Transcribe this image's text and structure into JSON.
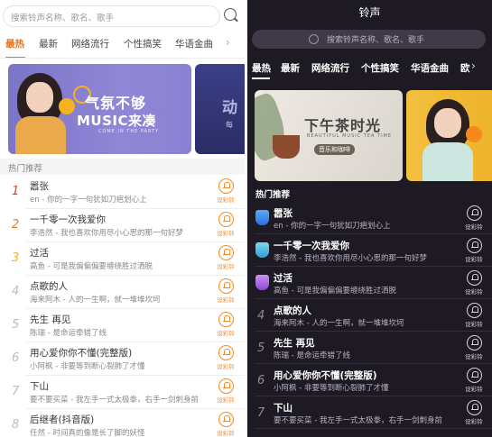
{
  "light": {
    "search": {
      "placeholder": "搜索铃声名称、歌名、歌手"
    },
    "tabs": [
      {
        "label": "最热",
        "active": true
      },
      {
        "label": "最新"
      },
      {
        "label": "网络流行"
      },
      {
        "label": "个性搞笑"
      },
      {
        "label": "华语金曲"
      }
    ],
    "banner": {
      "line1": "气氛不够",
      "line2": "MUSIC来凑",
      "line3": "COME IN THE PARTY"
    },
    "banner_next": {
      "title": "动",
      "sub": "每"
    },
    "section_title": "热门推荐",
    "set_label": "设彩铃",
    "songs": [
      {
        "rank": "1",
        "title": "嚣张",
        "sub": "en - 你的一字一句犹如刀疤划心上"
      },
      {
        "rank": "2",
        "title": "一千零一次我爱你",
        "sub": "李浩然 - 我也喜欢你用尽小心思的那一句好梦"
      },
      {
        "rank": "3",
        "title": "过活",
        "sub": "高鱼 - 可是我偏偏偏要缠绕胜过洒脱"
      },
      {
        "rank": "4",
        "title": "点歌的人",
        "sub": "海来阿木 - 人的一生啊，就一堆堆坎坷"
      },
      {
        "rank": "5",
        "title": "先生 再见",
        "sub": "陈瑞 - 是命运牵错了线"
      },
      {
        "rank": "6",
        "title": "用心爱你你不懂(完整版)",
        "sub": "小阿枫 - 非要等到断心裂肺了才懂"
      },
      {
        "rank": "7",
        "title": "下山",
        "sub": "要不要买菜 - 我左手一式太极拳，右手一剑刺身前"
      },
      {
        "rank": "8",
        "title": "后继者(抖音版)",
        "sub": "任然 - 时间真的像是长了脚的妖怪"
      }
    ]
  },
  "dark": {
    "title": "铃声",
    "search": {
      "placeholder": "搜索铃声名称、歌名、歌手"
    },
    "tabs": [
      {
        "label": "最热",
        "active": true
      },
      {
        "label": "最新"
      },
      {
        "label": "网络流行"
      },
      {
        "label": "个性搞笑"
      },
      {
        "label": "华语金曲"
      },
      {
        "label": "欧"
      }
    ],
    "banner": {
      "line1": "下午茶时光",
      "line2": "BEAUTIFUL MUSIC TEA TIME",
      "line3": "音乐和咖啡"
    },
    "section_title": "热门推荐",
    "set_label": "设彩铃",
    "songs": [
      {
        "rank": "1",
        "title": "嚣张",
        "sub": "en - 你的一字一句犹如刀疤划心上"
      },
      {
        "rank": "2",
        "title": "一千零一次我爱你",
        "sub": "李浩然 - 我也喜欢你用尽小心思的那一句好梦"
      },
      {
        "rank": "3",
        "title": "过活",
        "sub": "高鱼 - 可是我偏偏偏要缠绕胜过洒脱"
      },
      {
        "rank": "4",
        "title": "点歌的人",
        "sub": "海来阿木 - 人的一生啊，就一堆堆坎坷"
      },
      {
        "rank": "5",
        "title": "先生 再见",
        "sub": "陈瑞 - 是命运牵错了线"
      },
      {
        "rank": "6",
        "title": "用心爱你你不懂(完整版)",
        "sub": "小阿枫 - 非要等到断心裂肺了才懂"
      },
      {
        "rank": "7",
        "title": "下山",
        "sub": "要不要买菜 - 我左手一式太极拳，右手一剑刺身前"
      }
    ]
  },
  "colors": {
    "accent_light": "#e9741a",
    "dark_bg": "#1e1a24"
  }
}
